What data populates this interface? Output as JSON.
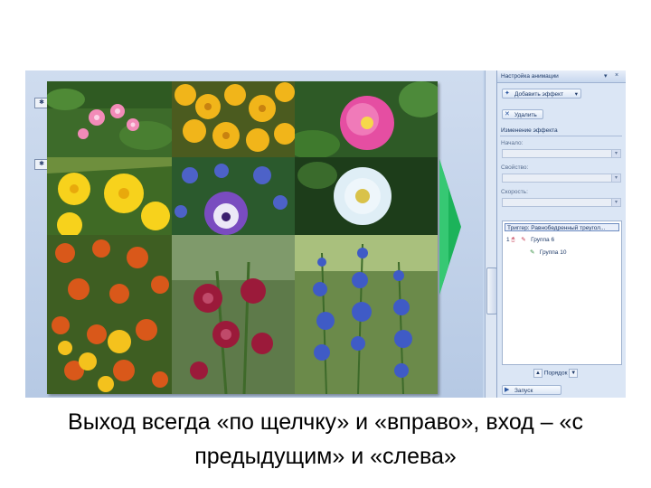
{
  "slide_caption": "Выход всегда «по щелчку» и «вправо», вход – «с предыдущим» и «слева»",
  "slide_markers": [
    "✱",
    "✱"
  ],
  "task_pane": {
    "title": "Настройка анимации",
    "header_dropdown_icon": "chevron-down-icon",
    "close_glyph": "×",
    "add_effect_label": "Добавить эффект",
    "remove_label": "Удалить",
    "change_effect_label": "Изменение эффекта",
    "start_label": "Начало:",
    "property_label": "Свойство:",
    "speed_label": "Скорость:",
    "trigger_label": "Триггер: Равнобедренный треугол...",
    "effects": [
      {
        "number": "1",
        "label": "Группа 6"
      },
      {
        "number": "",
        "label": "Группа 10"
      }
    ],
    "reorder_label": "Порядок",
    "play_label": "Запуск"
  },
  "colors": {
    "pane_bg": "#dbe6f5",
    "workspace_bg": "#c5d6ec",
    "arrow_green": "#1cb35a",
    "caption_text": "#000000"
  }
}
